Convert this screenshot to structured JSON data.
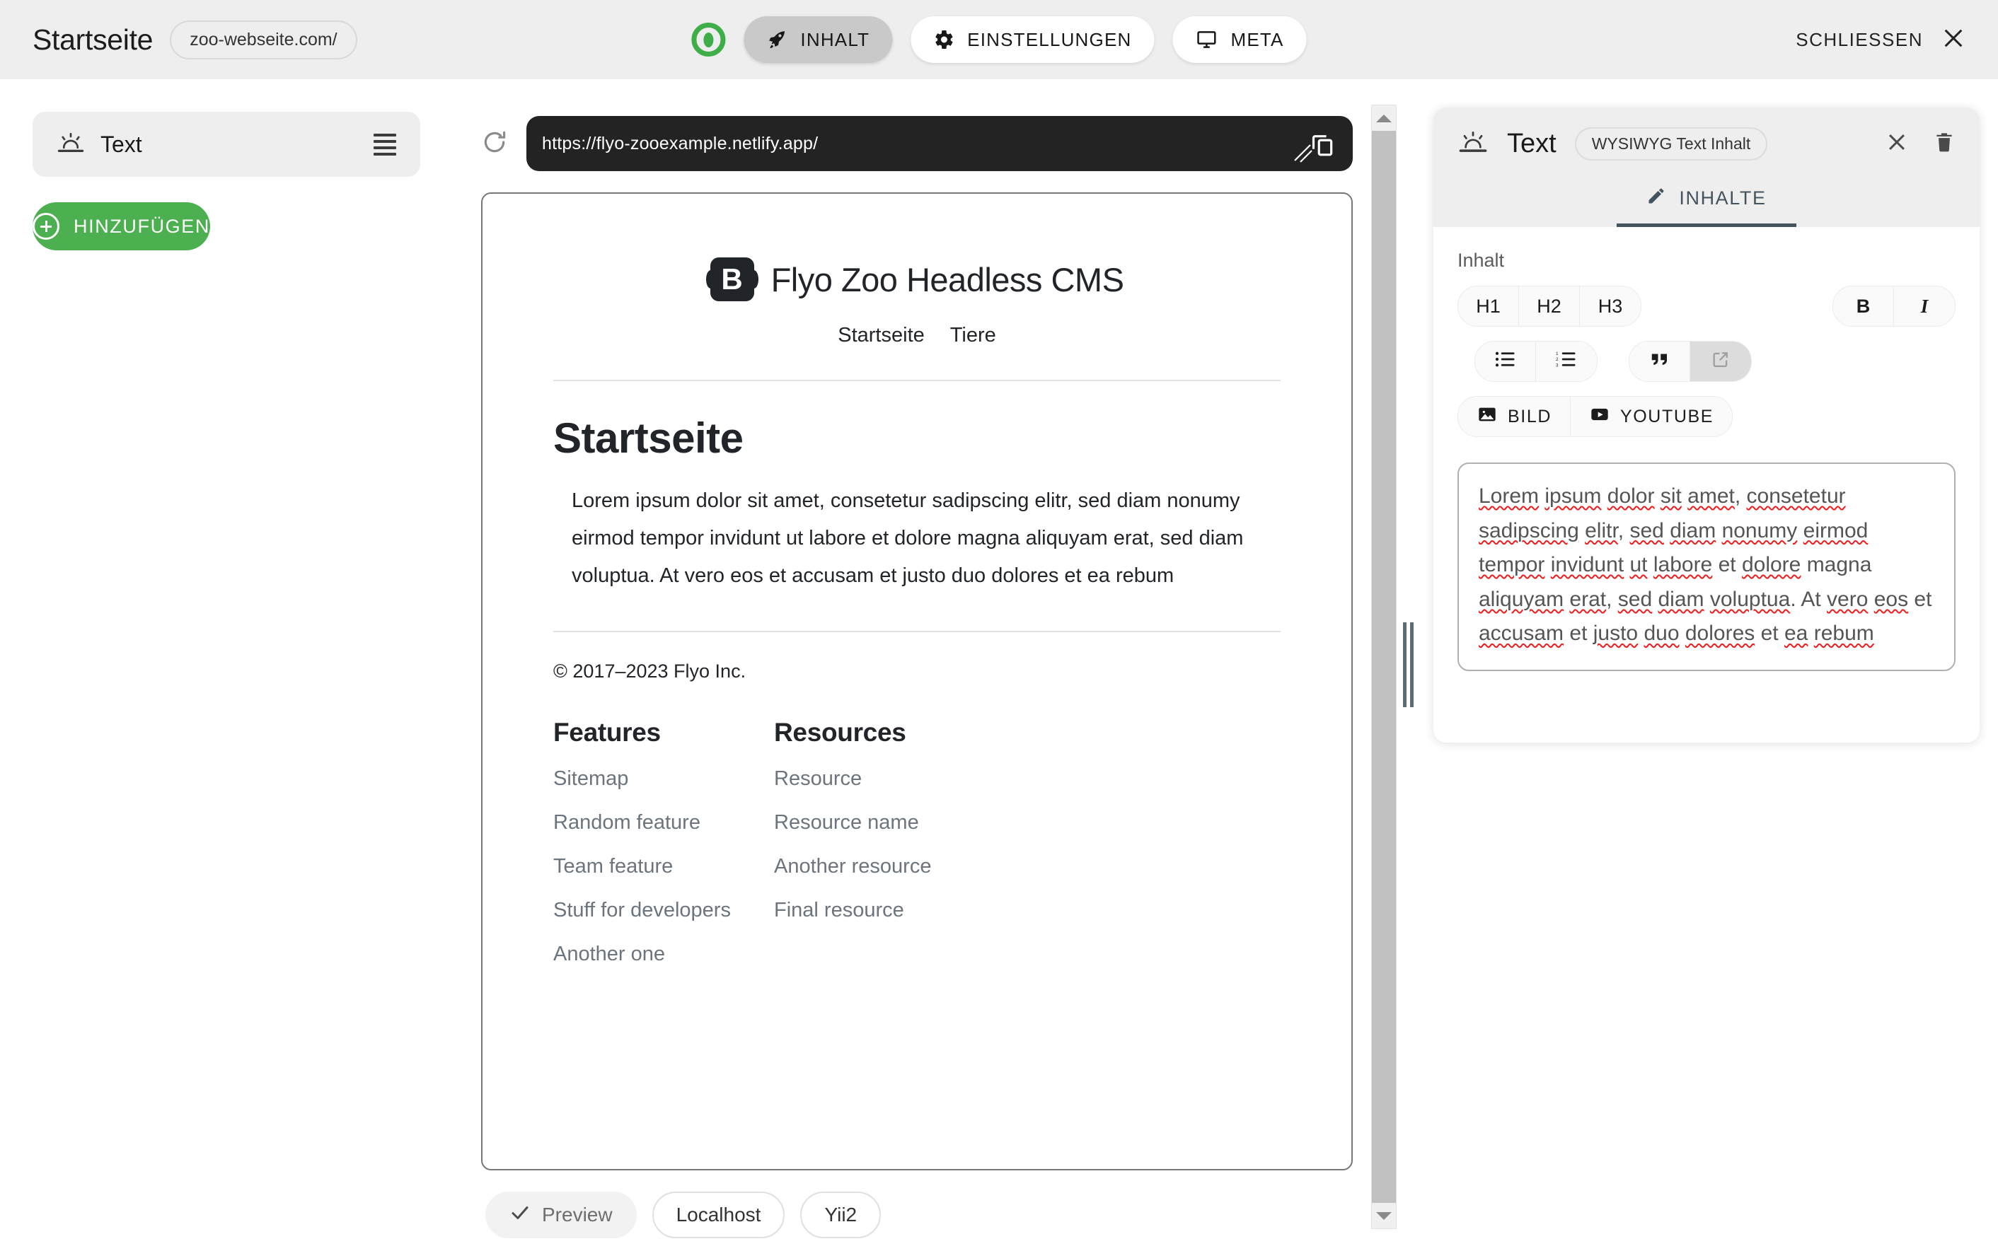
{
  "topbar": {
    "page_title": "Startseite",
    "domain": "zoo-webseite.com/",
    "status_icon": "eye-icon",
    "nav": [
      {
        "label": "INHALT",
        "icon": "rocket-icon",
        "active": true
      },
      {
        "label": "EINSTELLUNGEN",
        "icon": "gear-icon",
        "active": false
      },
      {
        "label": "META",
        "icon": "monitor-icon",
        "active": false
      }
    ],
    "close_label": "SCHLIESSEN",
    "close_icon": "close-icon"
  },
  "sidebar": {
    "block": {
      "label": "Text",
      "icon": "text-block-icon",
      "drag_icon": "drag-handle-icon"
    },
    "add_button": {
      "label": "HINZUFÜGEN",
      "icon": "plus-circle-icon"
    }
  },
  "preview": {
    "reload_icon": "reload-icon",
    "url": "https://flyo-zooexample.netlify.app/",
    "copy_icon": "copy-icon",
    "site": {
      "brand_initial": "B",
      "brand_name": "Flyo Zoo Headless CMS",
      "nav": [
        "Startseite",
        "Tiere"
      ],
      "heading": "Startseite",
      "paragraph": "Lorem ipsum dolor sit amet, consetetur sadipscing elitr, sed diam nonumy eirmod tempor invidunt ut labore et dolore magna aliquyam erat, sed diam voluptua. At vero eos et accusam et justo duo dolores et ea rebum",
      "copyright": "© 2017–2023 Flyo Inc.",
      "columns": [
        {
          "title": "Features",
          "links": [
            "Sitemap",
            "Random feature",
            "Team feature",
            "Stuff for developers",
            "Another one"
          ]
        },
        {
          "title": "Resources",
          "links": [
            "Resource",
            "Resource name",
            "Another resource",
            "Final resource"
          ]
        }
      ]
    },
    "tabs": [
      {
        "label": "Preview",
        "icon": "check-icon",
        "active": true
      },
      {
        "label": "Localhost",
        "icon": "",
        "active": false
      },
      {
        "label": "Yii2",
        "icon": "",
        "active": false
      }
    ]
  },
  "right_panel": {
    "title": "Text",
    "title_icon": "text-block-icon",
    "badge": "WYSIWYG Text Inhalt",
    "close_icon": "close-icon",
    "delete_icon": "trash-icon",
    "tab": {
      "label": "INHALTE",
      "icon": "pencil-icon"
    },
    "field_label": "Inhalt",
    "toolbar": {
      "headings": [
        "H1",
        "H2",
        "H3"
      ],
      "format": [
        {
          "label": "B",
          "name": "bold"
        },
        {
          "label": "I",
          "name": "italic"
        }
      ],
      "lists": [
        {
          "label": "",
          "name": "bullet-list-icon"
        },
        {
          "label": "",
          "name": "numbered-list-icon"
        }
      ],
      "inserts": [
        {
          "label": "",
          "name": "quote-icon",
          "active": false
        },
        {
          "label": "",
          "name": "link-icon",
          "active": true
        }
      ],
      "media": [
        {
          "label": "BILD",
          "name": "image-icon"
        },
        {
          "label": "YOUTUBE",
          "name": "youtube-icon"
        }
      ]
    },
    "editor_text": "Lorem ipsum dolor sit amet, consetetur sadipscing elitr, sed diam nonumy eirmod tempor invidunt ut labore et dolore magna aliquyam erat, sed diam voluptua. At vero eos et accusam et justo duo dolores et ea rebum"
  },
  "colors": {
    "accent_green": "#4caf50",
    "topbar_bg": "#eeeeee",
    "url_bar_bg": "#232323",
    "tab_underline": "#44545e",
    "spellcheck": "#ee1c1c"
  }
}
